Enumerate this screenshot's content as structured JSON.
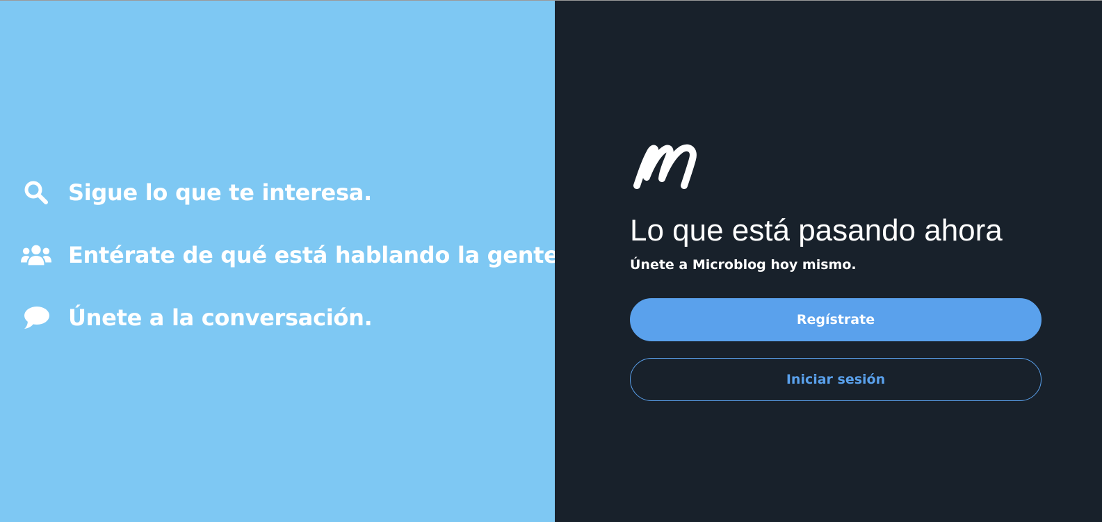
{
  "features": [
    {
      "icon": "search-icon",
      "text": "Sigue lo que te interesa."
    },
    {
      "icon": "users-icon",
      "text": "Entérate de qué está hablando la gente."
    },
    {
      "icon": "comment-icon",
      "text": "Únete a la conversación."
    }
  ],
  "brand": {
    "logo_icon": "microblog-logo-icon"
  },
  "hero": {
    "headline": "Lo que está pasando ahora",
    "subline": "Únete a Microblog hoy mismo."
  },
  "buttons": {
    "register": "Regístrate",
    "login": "Iniciar sesión"
  },
  "colors": {
    "left_bg": "#7ec8f3",
    "right_bg": "#18212b",
    "accent": "#5aa1ec",
    "text": "#ffffff"
  }
}
